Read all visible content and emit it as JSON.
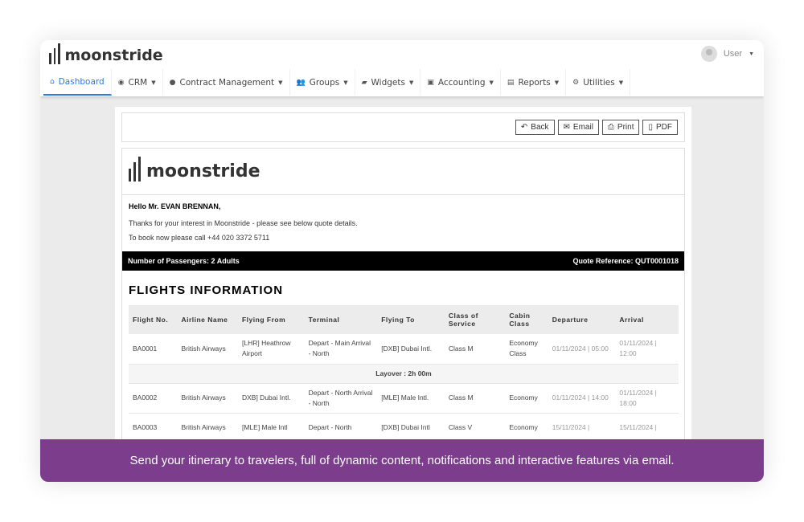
{
  "app": {
    "brand": "moonstride",
    "user": "User"
  },
  "nav": [
    {
      "label": "Dashboard",
      "icon": "home-icon",
      "glyph": "⌂"
    },
    {
      "label": "CRM",
      "icon": "user-circle-icon",
      "glyph": "◉"
    },
    {
      "label": "Contract Management",
      "icon": "globe-icon",
      "glyph": "●"
    },
    {
      "label": "Groups",
      "icon": "users-icon",
      "glyph": "👥"
    },
    {
      "label": "Widgets",
      "icon": "folder-open-icon",
      "glyph": "▰"
    },
    {
      "label": "Accounting",
      "icon": "money-icon",
      "glyph": "▣"
    },
    {
      "label": "Reports",
      "icon": "file-icon",
      "glyph": "▤"
    },
    {
      "label": "Utilities",
      "icon": "cogs-icon",
      "glyph": "⚙"
    }
  ],
  "toolbar": {
    "back": "Back",
    "email": "Email",
    "print": "Print",
    "pdf": "PDF"
  },
  "quote": {
    "greeting": "Hello Mr. EVAN BRENNAN,",
    "line1": "Thanks for your interest in Moonstride - please see below quote details.",
    "line2": "To book now please call +44 020 3372 5711",
    "passengers": "Number of Passengers: 2 Adults",
    "reference": "Quote Reference: QUT0001018",
    "section_title": "FLIGHTS INFORMATION"
  },
  "table": {
    "headers": [
      "Flight No.",
      "Airline Name",
      "Flying From",
      "Terminal",
      "Flying To",
      "Class of Service",
      "Cabin Class",
      "Departure",
      "Arrival"
    ],
    "rows": [
      [
        "BA0001",
        "British Airways",
        "[LHR] Heathrow Airport",
        "Depart - Main Arrival - North",
        "[DXB] Dubai Intl.",
        "Class M",
        "Economy Class",
        "01/11/2024 | 05:00",
        "01/11/2024 | 12:00"
      ],
      [
        "BA0002",
        "British Airways",
        "DXB] Dubai Intl.",
        "Depart - North Arrival - North",
        "[MLE] Male Intl.",
        "Class M",
        "Economy",
        "01/11/2024 | 14:00",
        "01/11/2024 | 18:00"
      ],
      [
        "BA0003",
        "British Airways",
        "[MLE] Male Intl",
        "Depart - North",
        "[DXB] Dubai Intl",
        "Class V",
        "Economy",
        "15/11/2024 |",
        "15/11/2024 |"
      ]
    ],
    "layover": "Layover : 2h 00m"
  },
  "banner": "Send your itinerary to travelers, full of dynamic content, notifications and interactive features via email.",
  "colors": {
    "accent": "#2a7ae2",
    "banner": "#7b3d8c"
  }
}
